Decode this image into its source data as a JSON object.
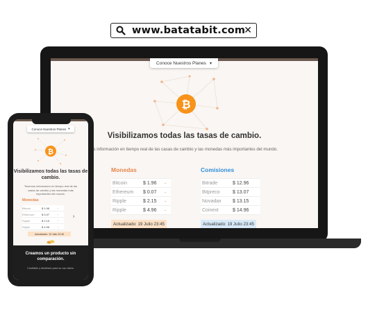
{
  "browser": {
    "url": "www.batatabit.com"
  },
  "laptop": {
    "plans_label": "Conoce Nuestros Planes",
    "headline": "Visibilizamos todas las tasas de cambio.",
    "subline": "os información en tiempo real de las casas de cambio y las monedas más importantes del mundo.",
    "monedas": {
      "title": "Monedas",
      "rows": [
        {
          "name": "Bitcoin",
          "value": "$ 1.96"
        },
        {
          "name": "Ethereum",
          "value": "$ 0.07"
        },
        {
          "name": "Ripple",
          "value": "$ 2.15"
        },
        {
          "name": "Ripple",
          "value": "$ 4.96"
        }
      ],
      "updated": "Actualizado: 19 Julio 23:45"
    },
    "comisiones": {
      "title": "Comisiones",
      "rows": [
        {
          "name": "Bitrade",
          "value": "$ 12.96"
        },
        {
          "name": "Bitpreco",
          "value": "$ 13.07"
        },
        {
          "name": "Novadax",
          "value": "$ 13.15"
        },
        {
          "name": "Coinext",
          "value": "$ 14.96"
        }
      ],
      "updated": "Actualizado: 19 Julio 23:45"
    }
  },
  "phone": {
    "plans_label": "Conoce Nuestros Planes",
    "headline": "Visibilizamos todas las tasas de cambio.",
    "subline": "Tenemos información en tiempo real de las casas de cambio y las monedas más importantes del mundo.",
    "monedas": {
      "title": "Monedas",
      "rows": [
        {
          "name": "Bitcoin",
          "value": "$ 1.96"
        },
        {
          "name": "Ethereum",
          "value": "$ 0.07"
        },
        {
          "name": "Ripple",
          "value": "$ 2.15"
        },
        {
          "name": "Ripple",
          "value": "$ 4.96"
        }
      ],
      "updated": "Actualizado: 19 Julio 23:45"
    },
    "dark_title": "Creamos un producto sin comparación.",
    "dark_sub": "Confiable y diseñado para su uso diario."
  },
  "colors": {
    "accent": "#e7874a",
    "blue": "#2f8fd8",
    "bitcoin": "#f7931a"
  }
}
